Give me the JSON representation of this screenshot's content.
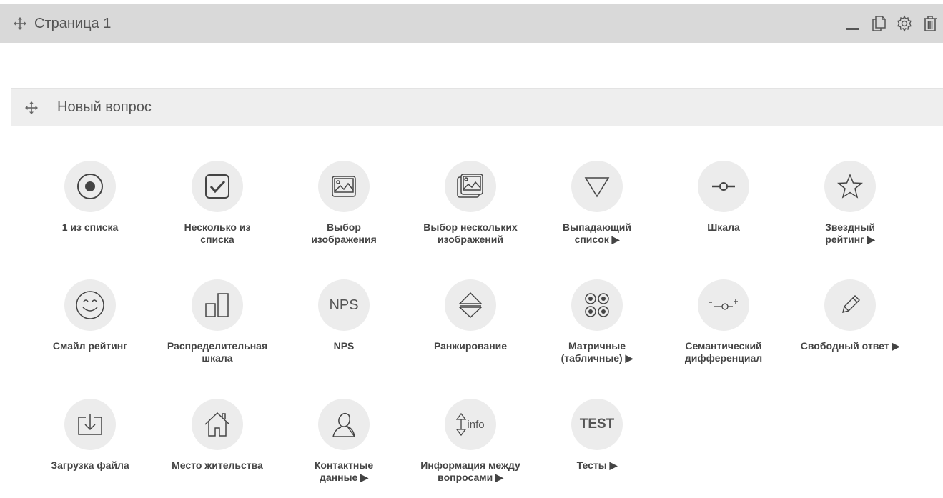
{
  "page": {
    "title": "Страница 1"
  },
  "toolbar": {
    "collapse_icon": "minimize-icon",
    "copy_icon": "copy-icon",
    "settings_icon": "gear-icon",
    "delete_icon": "trash-icon"
  },
  "question": {
    "title": "Новый вопрос"
  },
  "question_types": [
    {
      "label": "1 из списка",
      "icon": "radio-icon"
    },
    {
      "label": "Несколько из списка",
      "icon": "checkbox-icon"
    },
    {
      "label": "Выбор изображения",
      "icon": "image-icon"
    },
    {
      "label": "Выбор нескольких изображений",
      "icon": "images-icon"
    },
    {
      "label": "Выпадающий список ▶",
      "icon": "dropdown-triangle-icon"
    },
    {
      "label": "Шкала",
      "icon": "slider-icon"
    },
    {
      "label": "Звездный рейтинг ▶",
      "icon": "star-icon"
    },
    {
      "label": "Смайл рейтинг",
      "icon": "smile-icon"
    },
    {
      "label": "Распределительная шкала",
      "icon": "bars-icon"
    },
    {
      "label": "NPS",
      "icon": "nps-icon",
      "icon_text": "NPS"
    },
    {
      "label": "Ранжирование",
      "icon": "ranking-icon"
    },
    {
      "label": "Матричные (табличные) ▶",
      "icon": "matrix-icon"
    },
    {
      "label": "Семантический дифференциал",
      "icon": "semantic-icon"
    },
    {
      "label": "Свободный ответ ▶",
      "icon": "pencil-icon"
    },
    {
      "label": "Загрузка файла",
      "icon": "upload-icon"
    },
    {
      "label": "Место жительства",
      "icon": "house-icon"
    },
    {
      "label": "Контактные данные ▶",
      "icon": "person-icon"
    },
    {
      "label": "Информация между вопросами ▶",
      "icon": "info-icon",
      "icon_text": "info"
    },
    {
      "label": "Тесты ▶",
      "icon": "test-icon",
      "icon_text": "TEST"
    }
  ]
}
